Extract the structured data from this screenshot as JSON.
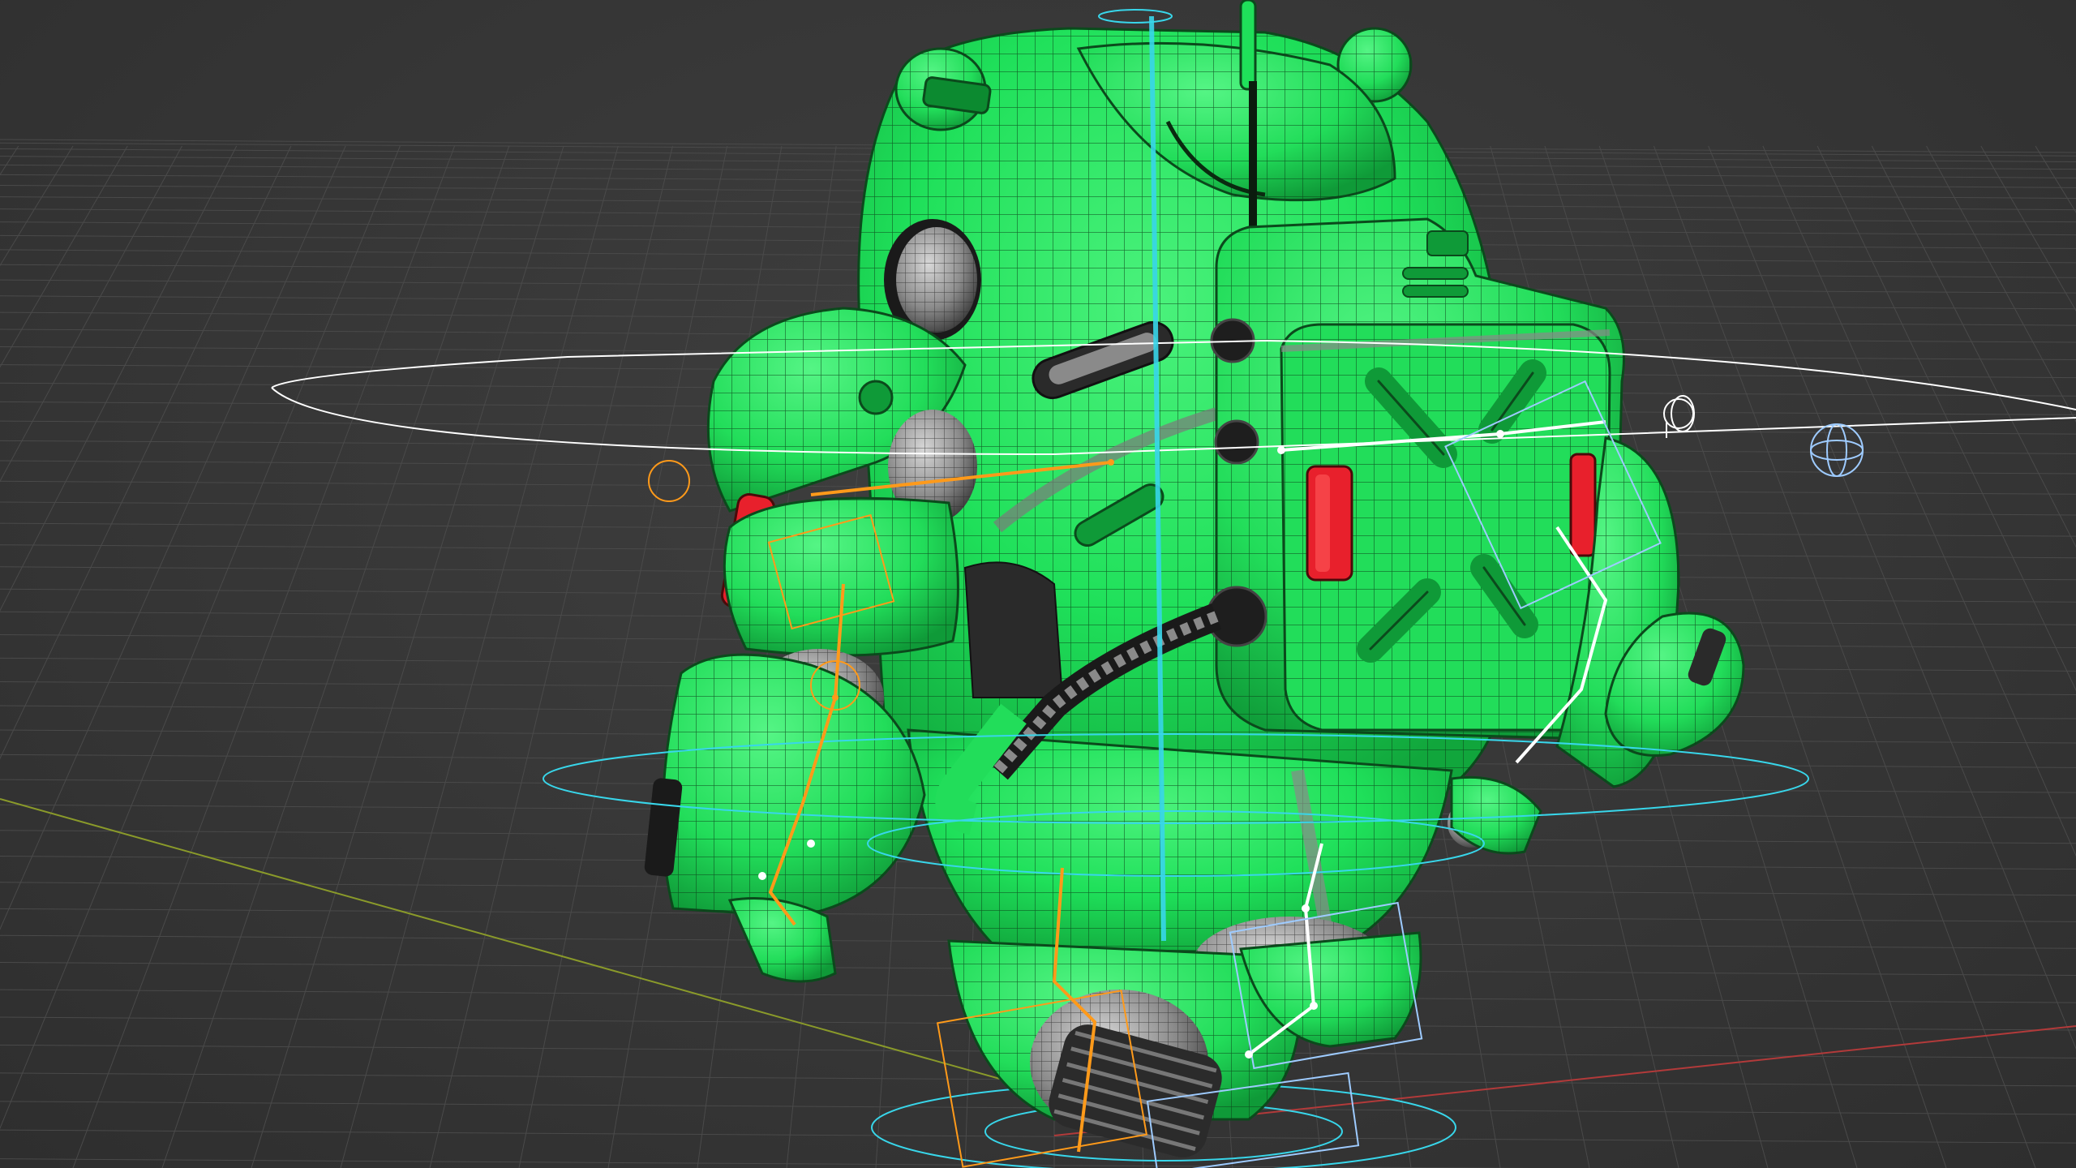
{
  "viewport": {
    "background_color": "#393939",
    "grid_line_color": "#4a4a4a",
    "x_axis_color": "#b23a3a",
    "y_axis_color": "#8a9a2a",
    "mesh_color": "#1fe05a",
    "mesh_shadow_color": "#13a83f",
    "wireframe_color": "#0a3a16",
    "accent_red": "#e8202c",
    "rig_orange": "#ff9a1a",
    "rig_white": "#ffffff",
    "rig_cyan": "#38d6ea",
    "rig_light_blue": "#9ecbff"
  },
  "scene": {
    "object": "robot-character",
    "display_mode": "solid-with-wireframe",
    "rig_overlay": "visible"
  }
}
